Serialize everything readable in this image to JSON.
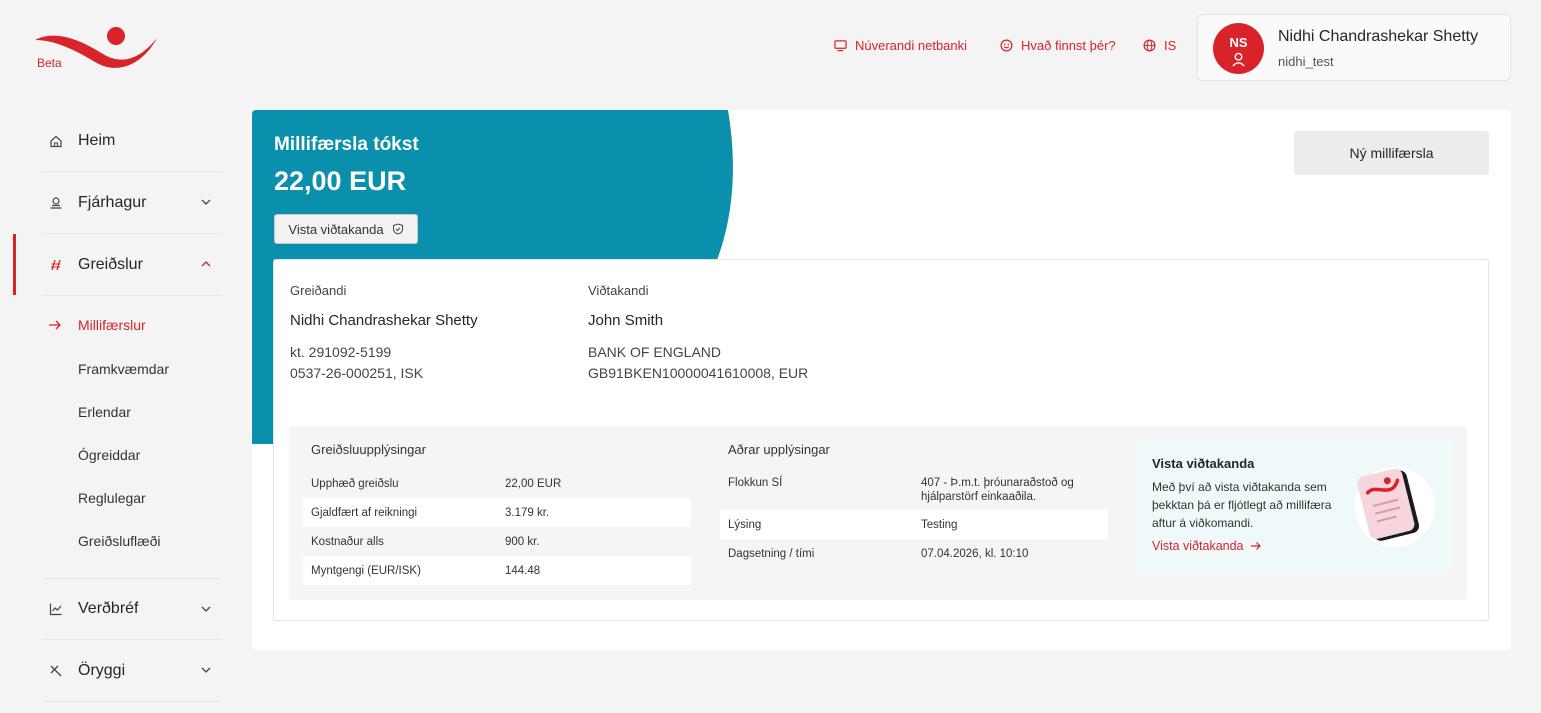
{
  "header": {
    "beta_label": "Beta",
    "links": {
      "current_bank": "Núverandi netbanki",
      "feedback": "Hvað finnst þér?",
      "language": "IS"
    },
    "user": {
      "initials": "NS",
      "name": "Nidhi Chandrashekar Shetty",
      "username": "nidhi_test"
    }
  },
  "sidebar": {
    "items": [
      {
        "label": "Heim",
        "icon": "home-icon"
      },
      {
        "label": "Fjárhagur",
        "icon": "finance-icon"
      },
      {
        "label": "Greiðslur",
        "icon": "payments-icon"
      },
      {
        "label": "Verðbréf",
        "icon": "chart-icon"
      },
      {
        "label": "Öryggi",
        "icon": "tools-icon"
      }
    ],
    "sub_items": [
      "Millifærslur",
      "Framkvæmdar",
      "Erlendar",
      "Ógreiddar",
      "Reglulegar",
      "Greiðsluflæði"
    ]
  },
  "main": {
    "title": "Millifærsla tókst",
    "amount": "22,00 EUR",
    "save_recipient_button": "Vista viðtakanda",
    "new_transfer_button": "Ný millifærsla",
    "payer": {
      "label": "Greiðandi",
      "name": "Nidhi Chandrashekar Shetty",
      "kt": "kt. 291092-5199",
      "account": "0537-26-000251, ISK"
    },
    "recipient": {
      "label": "Viðtakandi",
      "name": "John Smith",
      "bank": "BANK OF ENGLAND",
      "account": "GB91BKEN10000041610008, EUR"
    },
    "payment_info": {
      "title": "Greiðsluupplýsingar",
      "rows": [
        {
          "key": "Upphæð greiðslu",
          "value": "22,00 EUR"
        },
        {
          "key": "Gjaldfært af reikningi",
          "value": "3.179 kr."
        },
        {
          "key": "Kostnaður alls",
          "value": "900 kr."
        },
        {
          "key": "Myntgengi (EUR/ISK)",
          "value": "144.48"
        }
      ]
    },
    "other_info": {
      "title": "Aðrar upplýsingar",
      "rows": [
        {
          "key": "Flokkun SÍ",
          "value": "407 - Þ.m.t. þróunaraðstoð og",
          "value2": "hjálparstörf einkaaðila."
        },
        {
          "key": "Lýsing",
          "value": "Testing"
        },
        {
          "key": "Dagsetning / tími",
          "value": "07.04.2026, kl. 10:10"
        }
      ]
    },
    "promo": {
      "title": "Vista viðtakanda",
      "body": "Með því að vista viðtakanda sem þekktan þá er fljótlegt að millifæra aftur á viðkomandi.",
      "link": "Vista viðtakanda"
    }
  },
  "colors": {
    "brand_red": "#d8232a",
    "teal": "#0a8fad"
  }
}
